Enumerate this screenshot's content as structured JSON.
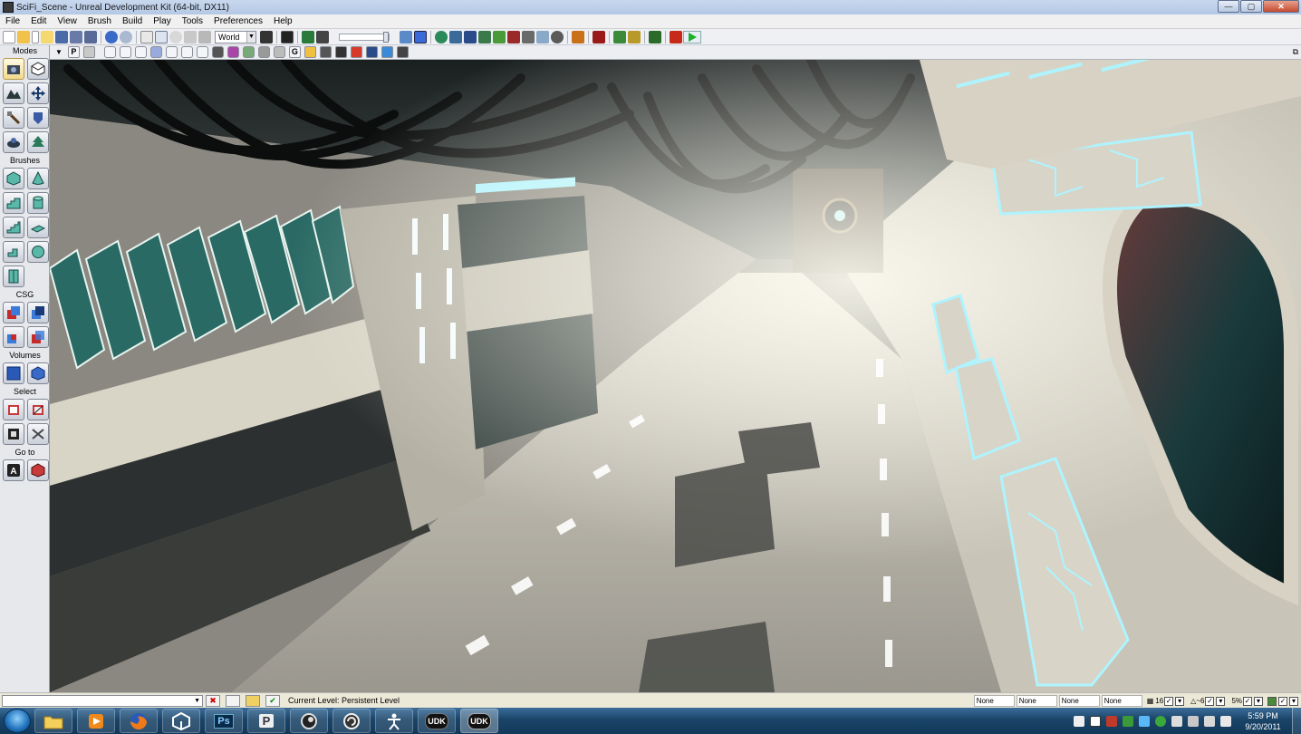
{
  "window": {
    "title": "SciFi_Scene - Unreal Development Kit (64-bit, DX11)",
    "controls": {
      "minimize": "—",
      "maximize": "▢",
      "close": "✕"
    }
  },
  "menu": [
    "File",
    "Edit",
    "View",
    "Brush",
    "Build",
    "Play",
    "Tools",
    "Preferences",
    "Help"
  ],
  "toolbar": {
    "coordinate_system": "World",
    "play_icon": "play-in-editor-icon"
  },
  "modes_panel": {
    "title": "Modes",
    "sections": {
      "brushes": "Brushes",
      "csg": "CSG",
      "volumes": "Volumes",
      "select": "Select",
      "goto": "Go to"
    }
  },
  "viewport_toolbar": {
    "perspective_label": "P",
    "grid_label": "G"
  },
  "status": {
    "current_level": "Current Level:  Persistent Level",
    "drop_fields": [
      "None",
      "None",
      "None",
      "None"
    ],
    "grid_size": "16",
    "rotation_snap": "~6",
    "scale_snap": "5%"
  },
  "taskbar": {
    "clock_time": "5:59 PM",
    "clock_date": "9/20/2011",
    "apps": [
      "Windows Explorer",
      "Media Player",
      "Firefox",
      "Unity",
      "Photoshop",
      "Perforce",
      "Steam",
      "Blender",
      "Pose tool",
      "UDK",
      "UDK"
    ],
    "udk_label": "UDK",
    "ps_label": "Ps",
    "p_label": "P"
  },
  "colors": {
    "accent": "#1d6fb8",
    "hull_light": "#e8e2d6",
    "hull_dark": "#2b2f30",
    "glow": "#aef4ff"
  }
}
